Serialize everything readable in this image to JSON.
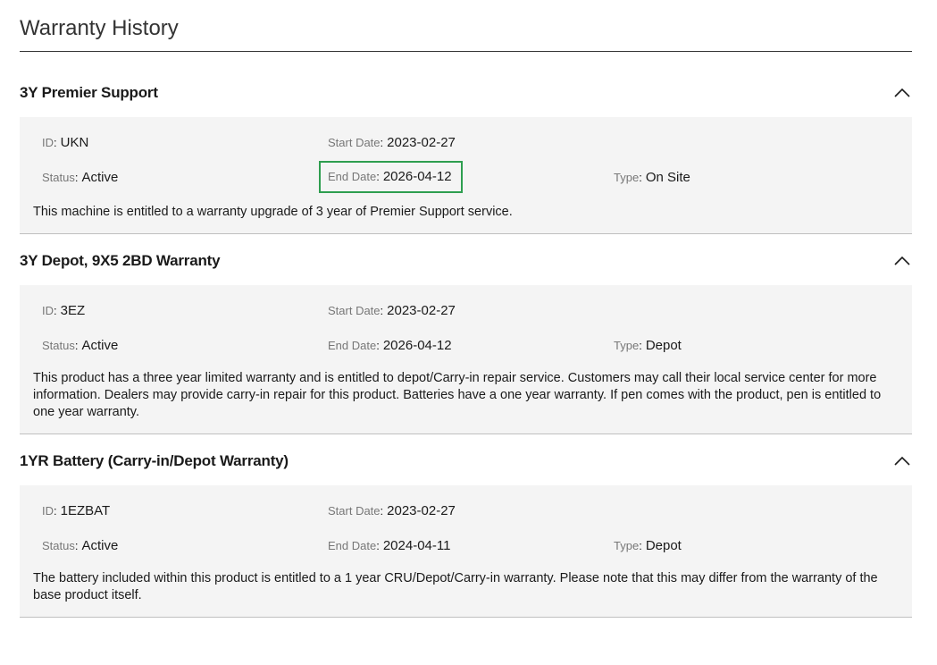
{
  "page": {
    "title": "Warranty History"
  },
  "labels": {
    "id": "ID",
    "start_date": "Start Date",
    "status": "Status",
    "end_date": "End Date",
    "type": "Type"
  },
  "sections": [
    {
      "title": "3Y Premier Support",
      "id": "UKN",
      "start_date": "2023-02-27",
      "status": "Active",
      "end_date": "2026-04-12",
      "type": "On Site",
      "description": "This machine is entitled to a warranty upgrade of 3 year of Premier Support service.",
      "icon": "chevron-up-icon"
    },
    {
      "title": "3Y Depot, 9X5 2BD Warranty",
      "id": "3EZ",
      "start_date": "2023-02-27",
      "status": "Active",
      "end_date": "2026-04-12",
      "type": "Depot",
      "description": "This product has a three year limited warranty and is entitled to depot/Carry-in repair service. Customers may call their local service center for more information. Dealers may provide carry-in repair for this product. Batteries have a one year warranty. If pen comes with the product, pen is entitled to one year warranty.",
      "icon": "chevron-up-icon"
    },
    {
      "title": "1YR Battery (Carry-in/Depot Warranty)",
      "id": "1EZBAT",
      "start_date": "2023-02-27",
      "status": "Active",
      "end_date": "2024-04-11",
      "type": "Depot",
      "description": "The battery included within this product is entitled to a 1 year CRU/Depot/Carry-in warranty. Please note that this may differ from the warranty of the base product itself.",
      "icon": "chevron-up-icon"
    }
  ],
  "colors": {
    "highlight_border": "#2e9e4f",
    "body_background": "#f4f4f4"
  }
}
